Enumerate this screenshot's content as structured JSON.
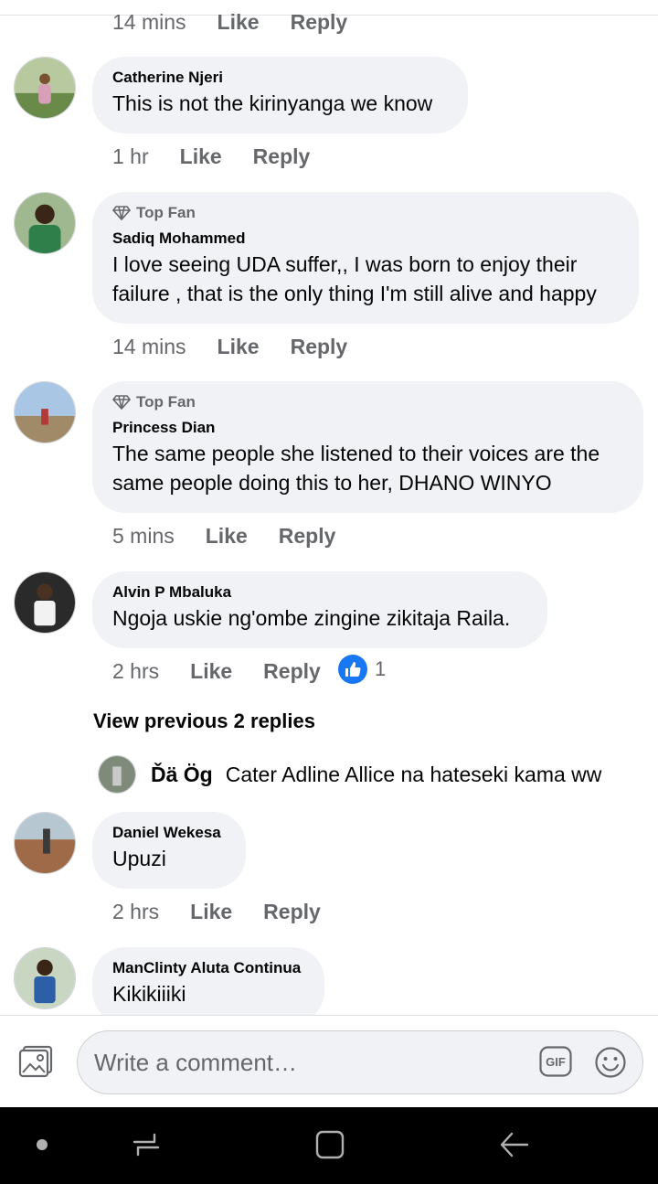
{
  "comments": [
    {
      "name": "",
      "text": "",
      "time": "14 mins",
      "like": "Like",
      "reply": "Reply"
    },
    {
      "name": "Catherine Njeri",
      "text": "This is not the kirinyanga we know",
      "time": "1 hr",
      "like": "Like",
      "reply": "Reply"
    },
    {
      "badge": "Top Fan",
      "name": "Sadiq Mohammed",
      "text_line1": "I love seeing UDA suffer,, I was born to enjoy their",
      "text_line2": "failure , that is the only thing I'm still alive and happy",
      "time": "14 mins",
      "like": "Like",
      "reply": "Reply"
    },
    {
      "badge": "Top Fan",
      "name": "Princess Dian",
      "text_line1": "The same people she listened to their voices are the",
      "text_line2": "same people doing this to her, DHANO WINYO",
      "time": "5 mins",
      "like": "Like",
      "reply": "Reply"
    },
    {
      "name": "Alvin P Mbaluka",
      "text": "Ngoja uskie ng'ombe zingine zikitaja Raila.",
      "time": "2 hrs",
      "like": "Like",
      "reply": "Reply",
      "reaction_count": "1"
    },
    {
      "name": "Daniel Wekesa",
      "text": "Upuzi",
      "time": "2 hrs",
      "like": "Like",
      "reply": "Reply"
    },
    {
      "name": "ManClinty Aluta Continua",
      "text": "Kikikiiiki"
    }
  ],
  "view_previous": "View previous 2 replies",
  "nested_reply": {
    "name": "Ďä Ög",
    "text": "Cater Adline Allice na hateseki kama ww"
  },
  "composer": {
    "placeholder": "Write a comment…",
    "gif_label": "GIF"
  },
  "icons": {
    "photo": "photo-icon",
    "gif": "gif-icon",
    "emoji": "emoji-icon",
    "like_reaction": "thumbs-up-icon",
    "top_fan": "diamond-icon",
    "nav_dot": "dot-icon",
    "nav_recent": "recent-apps-icon",
    "nav_home": "home-icon",
    "nav_back": "back-icon"
  },
  "colors": {
    "accent": "#1877f2",
    "bubble": "#f0f2f5",
    "meta": "#65676b",
    "navbar": "#000000"
  }
}
